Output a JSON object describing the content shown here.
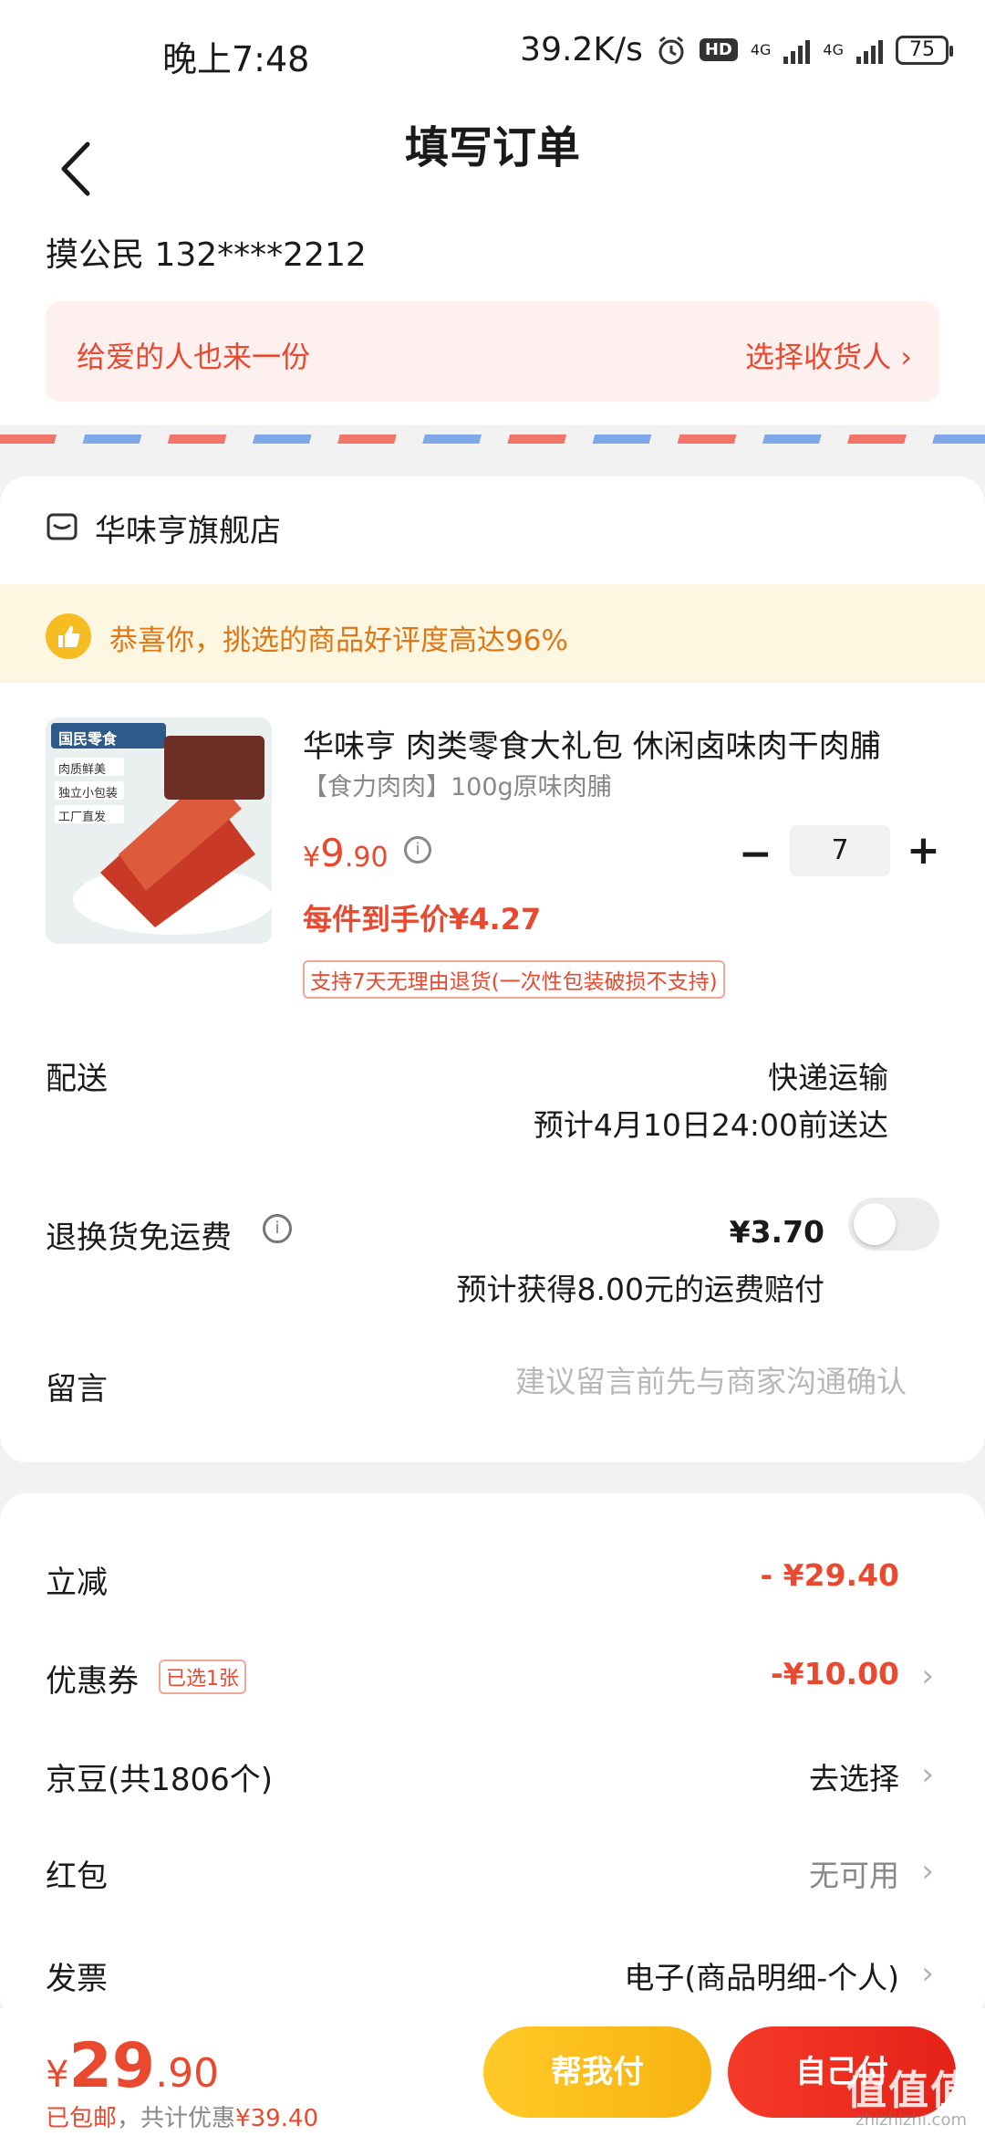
{
  "status_bar": {
    "time": "晚上7:48",
    "speed": "39.2K/s",
    "hd": "HD",
    "net1": "4G",
    "net2": "4G",
    "battery": "75"
  },
  "header": {
    "title": "填写订单"
  },
  "address": {
    "name": "摸公民",
    "phone": "132****2212",
    "gift_text": "给爱的人也来一份",
    "gift_link": "选择收货人 ›"
  },
  "store": {
    "name": "华味亨旗舰店",
    "rating_banner": "恭喜你，挑选的商品好评度高达96%",
    "product": {
      "title": "华味亨 肉类零食大礼包 休闲卤味肉干肉脯",
      "spec": "【食力肉肉】100g原味肉脯",
      "price_symbol": "¥",
      "price_int": "9",
      "price_dec": ".90",
      "unit_price": "每件到手价¥4.27",
      "quantity": "7",
      "return_policy": "支持7天无理由退货(一次性包装破损不支持)",
      "image_tags": [
        "国民零食",
        "肉质鲜美",
        "独立小包装",
        "工厂直发"
      ]
    },
    "delivery": {
      "label": "配送",
      "method": "快递运输",
      "eta": "预计4月10日24:00前送达"
    },
    "return_shipping": {
      "label": "退换货免运费",
      "price": "¥3.70",
      "note": "预计获得8.00元的运费赔付",
      "enabled": false
    },
    "remark": {
      "label": "留言",
      "placeholder": "建议留言前先与商家沟通确认"
    }
  },
  "promotions": {
    "discount": {
      "label": "立减",
      "value": "- ¥29.40"
    },
    "coupon": {
      "label": "优惠券",
      "tag": "已选1张",
      "value": "-¥10.00"
    },
    "jingdou": {
      "label": "京豆(共1806个)",
      "value": "去选择"
    },
    "red_packet": {
      "label": "红包",
      "value": "无可用"
    },
    "invoice": {
      "label": "发票",
      "value": "电子(商品明细-个人)"
    }
  },
  "footer": {
    "price_symbol": "¥",
    "price_int": "29",
    "price_dec": ".90",
    "shipping_note": "已包邮",
    "saving_prefix": "，共计优惠",
    "saving_value": "¥39.40",
    "help_pay_label": "帮我付",
    "self_pay_label": "自己付"
  },
  "watermark": {
    "text": "值值值",
    "site": "zhizhizhi.com"
  },
  "colors": {
    "accent": "#e8492f",
    "gold": "#f7b310",
    "banner_bg": "#fdf6e0"
  }
}
